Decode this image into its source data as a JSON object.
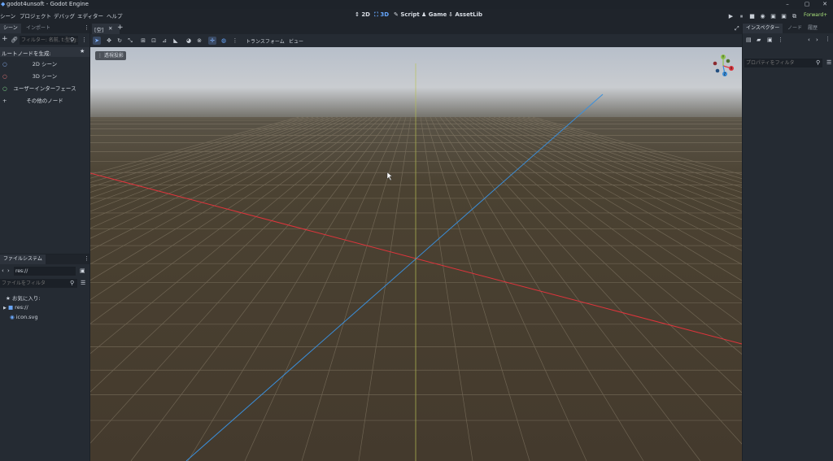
{
  "window": {
    "title": "godot4unsoft - Godot Engine",
    "minimize": "–",
    "maximize": "▢",
    "close": "✕"
  },
  "menu": [
    "シーン",
    "プロジェクト",
    "デバッグ",
    "エディター",
    "ヘルプ"
  ],
  "workspaces": [
    {
      "label": "2D",
      "icon": "↕"
    },
    {
      "label": "3D",
      "icon": "⛶"
    },
    {
      "label": "Script",
      "icon": "✎"
    },
    {
      "label": "Game",
      "icon": "♟"
    },
    {
      "label": "AssetLib",
      "icon": "⇩"
    }
  ],
  "run_buttons": [
    "▶",
    "⏸",
    "■",
    "◉",
    "▣",
    "▣",
    "⧉"
  ],
  "renderer": "Forward+",
  "scene_dock": {
    "tabs": [
      "シーン",
      "インポート"
    ],
    "filter_placeholder": "フィルター: 名前, t:型, g:",
    "header": "ルートノードを生成:",
    "items": [
      {
        "icon": "○",
        "label": "2D シーン"
      },
      {
        "icon": "○",
        "label": "3D シーン"
      },
      {
        "icon": "○",
        "label": "ユーザーインターフェース"
      },
      {
        "icon": "+",
        "label": "その他のノード"
      }
    ]
  },
  "filesystem_dock": {
    "tab": "ファイルシステム",
    "path": "res://",
    "filter_placeholder": "ファイルをフィルタ",
    "items": [
      {
        "icon": "★",
        "label": "お気に入り:"
      },
      {
        "icon": "▶",
        "label": "res://"
      },
      {
        "icon": "◉",
        "label": "icon.svg"
      }
    ]
  },
  "editor_tabs": [
    {
      "label": "[空]",
      "close": "✕"
    }
  ],
  "editor_add_tab": "+",
  "toolbar": {
    "transform_menu": "トランスフォーム",
    "view_menu": "ビュー"
  },
  "viewport": {
    "perspective_label": "透視投影",
    "gizmo": {
      "x": "X",
      "y": "Y",
      "z": "Z"
    }
  },
  "inspector_dock": {
    "tabs": [
      "インスペクター",
      "ノード",
      "履歴"
    ],
    "filter_placeholder": "プロパティをフィルタ"
  },
  "colors": {
    "accent": "#66a7ff",
    "x_axis": "#e0343c",
    "z_axis": "#3a8fdc",
    "y_axis": "#b6c24a"
  }
}
